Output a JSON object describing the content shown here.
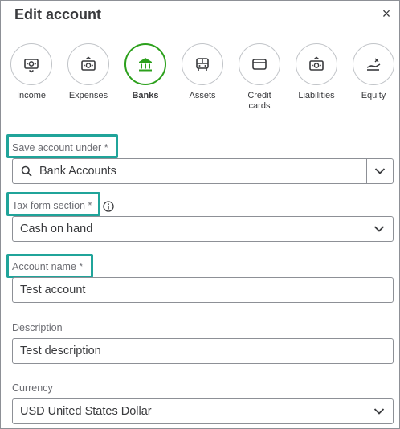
{
  "dialog": {
    "title": "Edit account",
    "close_label": "×"
  },
  "account_types": [
    {
      "label": "Income",
      "icon": "income-icon",
      "selected": false
    },
    {
      "label": "Expenses",
      "icon": "expenses-icon",
      "selected": false
    },
    {
      "label": "Banks",
      "icon": "bank-icon",
      "selected": true
    },
    {
      "label": "Assets",
      "icon": "assets-icon",
      "selected": false
    },
    {
      "label": "Credit cards",
      "icon": "credit-card-icon",
      "selected": false
    },
    {
      "label": "Liabilities",
      "icon": "liabilities-icon",
      "selected": false
    },
    {
      "label": "Equity",
      "icon": "equity-icon",
      "selected": false
    }
  ],
  "save_under": {
    "label": "Save account under",
    "required_mark": "*",
    "value": "Bank Accounts",
    "icon": "search-icon"
  },
  "tax_form": {
    "label": "Tax form section",
    "required_mark": "*",
    "value": "Cash on hand",
    "info_icon": "info-icon"
  },
  "account_name": {
    "label": "Account name",
    "required_mark": "*",
    "value": "Test account"
  },
  "description": {
    "label": "Description",
    "value": "Test description"
  },
  "currency": {
    "label": "Currency",
    "value": "USD United States Dollar"
  },
  "colors": {
    "selected_accent": "#2ca01c",
    "highlight_box": "#20a49a",
    "text": "#393a3d",
    "label": "#6b6c72",
    "border": "#8d9096"
  }
}
